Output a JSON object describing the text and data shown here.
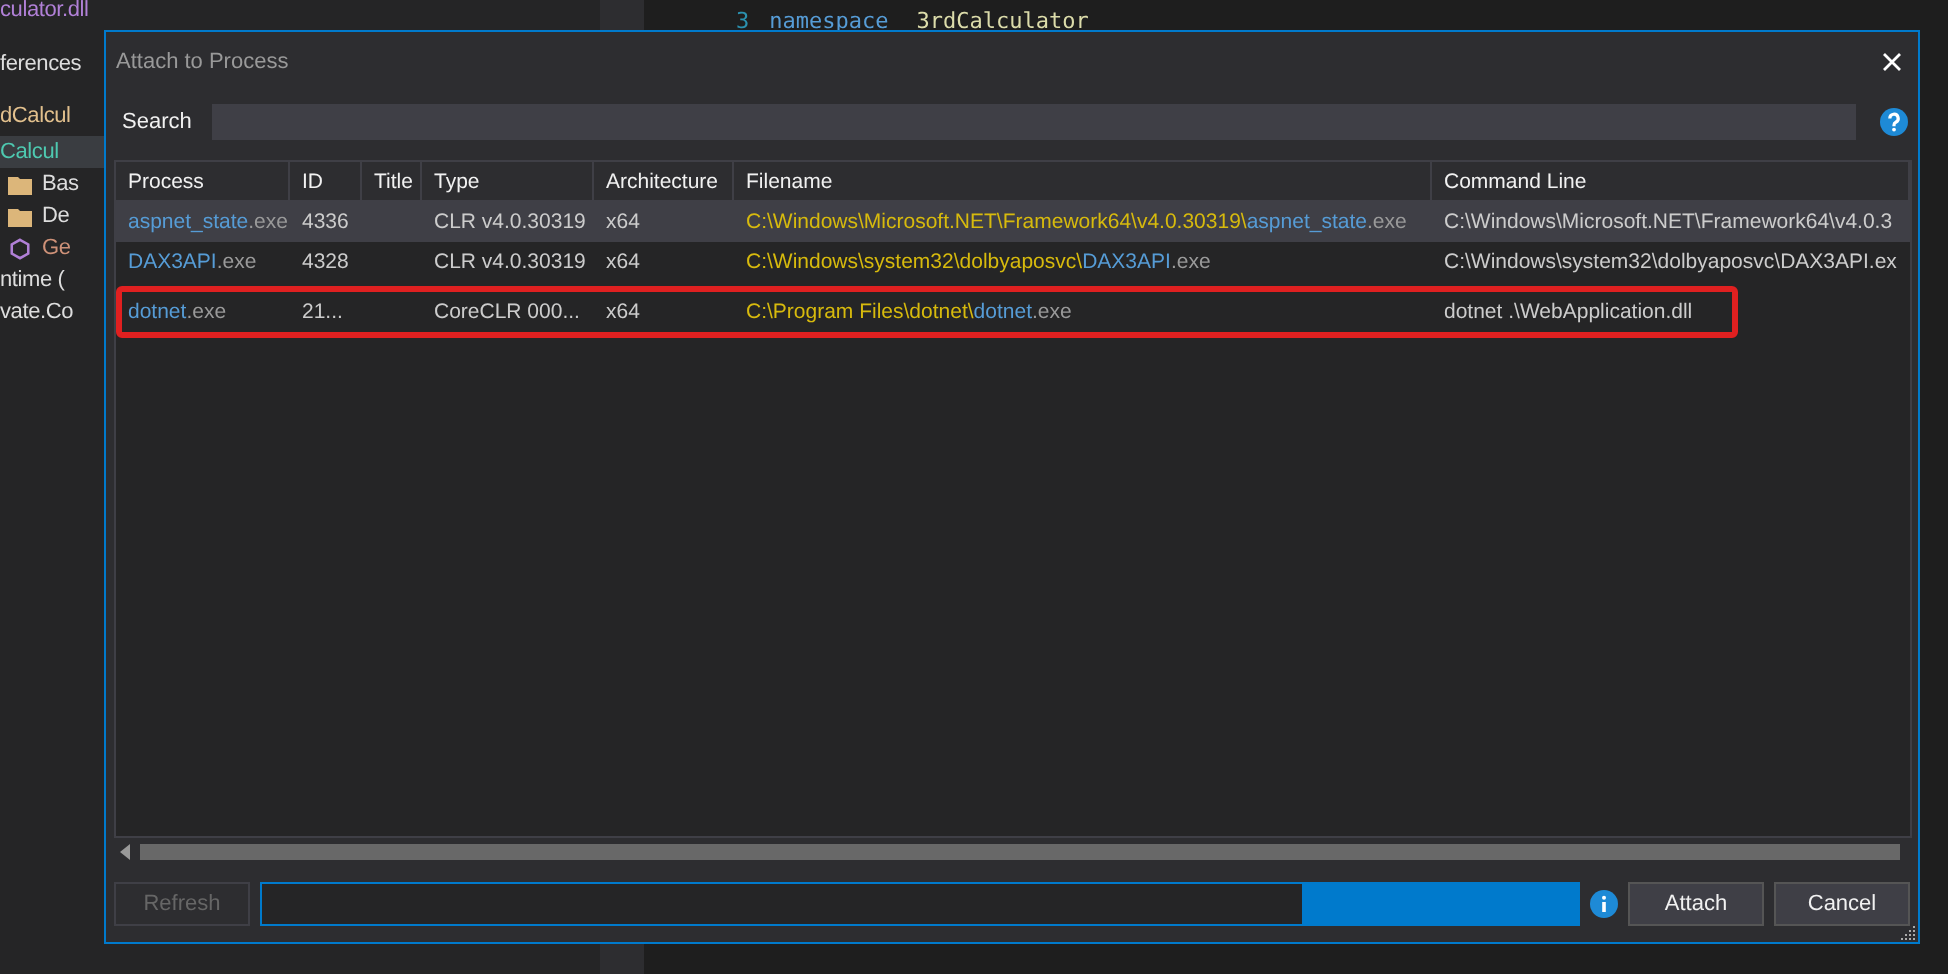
{
  "explorer": {
    "items": [
      {
        "text": "culator.dll",
        "kind": "file"
      },
      {
        "text": "ferences",
        "kind": "plain"
      },
      {
        "text": "dCalcul",
        "kind": "project"
      },
      {
        "text": "Calcul",
        "kind": "namespace"
      },
      {
        "text": "Bas",
        "kind": "folder"
      },
      {
        "text": "De",
        "kind": "folder"
      },
      {
        "text": "Ge",
        "kind": "class"
      },
      {
        "text": "ntime (",
        "kind": "plain"
      },
      {
        "text": "vate.Co",
        "kind": "plain"
      }
    ]
  },
  "editor": {
    "lines": [
      {
        "number": "3",
        "tokens": [
          {
            "text": "namespace",
            "kind": "keyword"
          },
          {
            "text": "3rdCalculator",
            "kind": "name"
          }
        ]
      }
    ]
  },
  "dialog": {
    "title": "Attach to Process",
    "search": {
      "label": "Search"
    },
    "table": {
      "columns": [
        "Process",
        "ID",
        "Title",
        "Type",
        "Architecture",
        "Filename",
        "Command Line"
      ],
      "rows": [
        {
          "process": {
            "name": "aspnet_state",
            "ext": ".exe"
          },
          "id": "4336",
          "type": "CLR v4.0.30319",
          "architecture": "x64",
          "filename": {
            "dir": "C:\\Windows\\Microsoft.NET\\Framework64\\v4.0.30319\\",
            "name": "aspnet_state",
            "ext": ".exe"
          },
          "command_line": "C:\\Windows\\Microsoft.NET\\Framework64\\v4.0.3",
          "selected": true,
          "annotated": false
        },
        {
          "process": {
            "name": "DAX3API",
            "ext": ".exe"
          },
          "id": "4328",
          "type": "CLR v4.0.30319",
          "architecture": "x64",
          "filename": {
            "dir": "C:\\Windows\\system32\\dolbyaposvc\\",
            "name": "DAX3API",
            "ext": ".exe"
          },
          "command_line": "C:\\Windows\\system32\\dolbyaposvc\\DAX3API.ex",
          "selected": false,
          "annotated": false
        },
        {
          "process": {
            "name": "dotnet",
            "ext": ".exe"
          },
          "id": "21...",
          "type": "CoreCLR 000...",
          "architecture": "x64",
          "filename": {
            "dir": "C:\\Program Files\\dotnet\\",
            "name": "dotnet",
            "ext": ".exe"
          },
          "command_line": "dotnet .\\WebApplication.dll",
          "selected": false,
          "annotated": true
        }
      ]
    },
    "progress": {
      "level": 0.21
    },
    "buttons": [
      {
        "label": "Refresh",
        "kind": "refresh",
        "disabled": true
      },
      {
        "label": "Attach",
        "kind": "attach",
        "disabled": false
      },
      {
        "label": "Cancel",
        "kind": "cancel",
        "disabled": false
      }
    ]
  }
}
